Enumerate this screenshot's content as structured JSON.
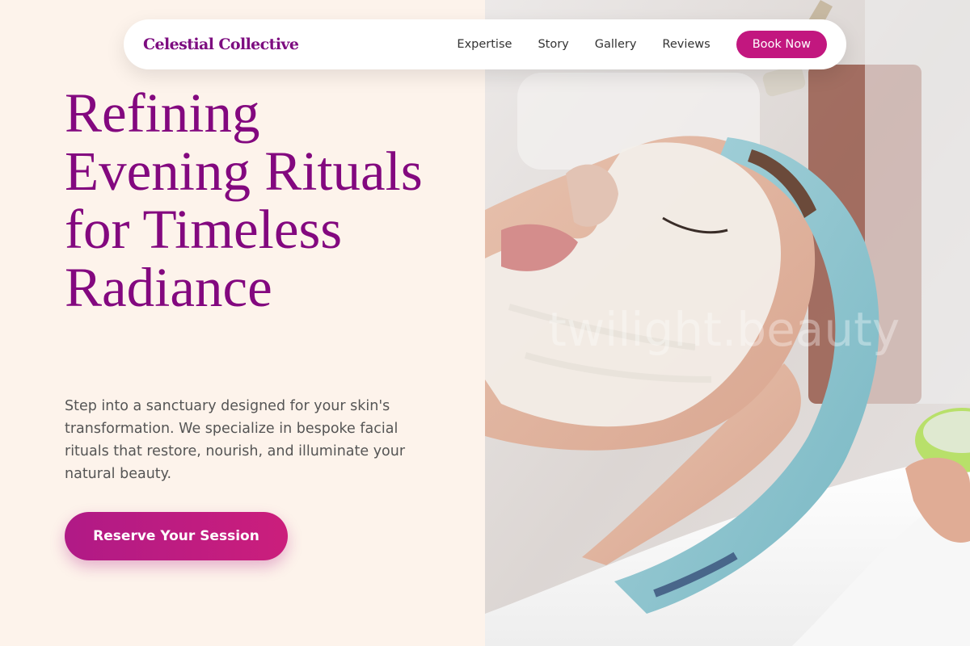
{
  "brand": {
    "name": "Celestial Collective"
  },
  "nav": {
    "links": [
      "Expertise",
      "Story",
      "Gallery",
      "Reviews"
    ],
    "cta": "Book Now"
  },
  "hero": {
    "title": "Refining Evening Rituals for Timeless Radiance",
    "description": "Step into a sanctuary designed for your skin's transformation. We specialize in bespoke facial rituals that restore, nourish, and illuminate your natural beauty.",
    "cta": "Reserve Your Session"
  },
  "image": {
    "watermark": "twilight.beauty",
    "subject": "facial-treatment-photo"
  },
  "colors": {
    "brand": "#7d0d80",
    "accent": "#c2177f",
    "background": "#fdf3eb"
  }
}
